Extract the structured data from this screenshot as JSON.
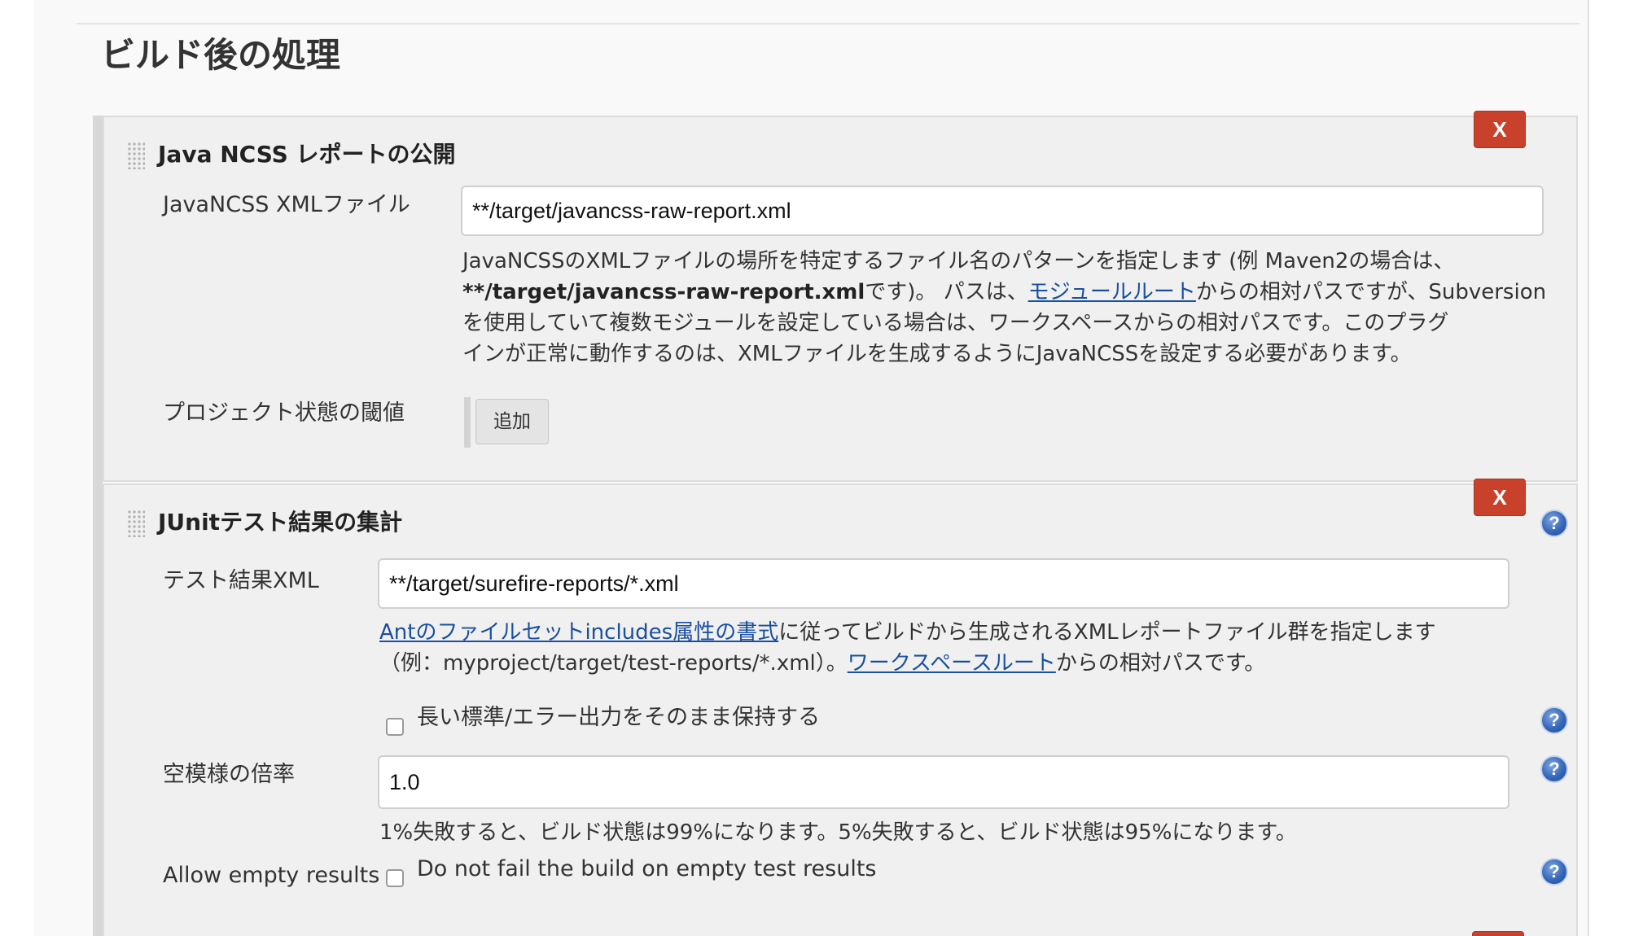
{
  "section": {
    "title": "ビルド後の処理"
  },
  "ncss": {
    "title": "Java NCSS レポートの公開",
    "delete_label": "X",
    "xml_label": "JavaNCSS XMLファイル",
    "xml_value": "**/target/javancss-raw-report.xml",
    "desc": {
      "line1": "JavaNCSSのXMLファイルの場所を特定するファイル名のパターンを指定します (例 Maven2の場合は、",
      "bold": "**/target/javancss-raw-report.xml",
      "after_bold": "です)。 パスは、",
      "link": "モジュールルート",
      "after_link": "からの相対パスですが、Subversion",
      "line3": "を使用していて複数モジュールを設定している場合は、ワークスペースからの相対パスです。このプラグ",
      "line4": "インが正常に動作するのは、XMLファイルを生成するようにJavaNCSSを設定する必要があります。"
    },
    "threshold_label": "プロジェクト状態の閾値",
    "add_label": "追加"
  },
  "junit": {
    "title": "JUnitテスト結果の集計",
    "delete_label": "X",
    "help_label": "?",
    "xml_label": "テスト結果XML",
    "xml_value": "**/target/surefire-reports/*.xml",
    "desc": {
      "link1": "Antのファイルセットincludes属性の書式",
      "after_link1": "に従ってビルドから生成されるXMLレポートファイル群を指定します",
      "line2_pre": "（例：myproject/target/test-reports/*.xml）。",
      "link2": "ワークスペースルート",
      "line2_post": "からの相対パスです。"
    },
    "keep_output_label": "長い標準/エラー出力をそのまま保持する",
    "health_label": "空模様の倍率",
    "health_value": "1.0",
    "health_desc": "1%失敗すると、ビルド状態は99%になります。5%失敗すると、ビルド状態は95%になります。",
    "allow_empty_label": "Allow empty results",
    "allow_empty_check_label": "Do not fail the build on empty test results"
  }
}
